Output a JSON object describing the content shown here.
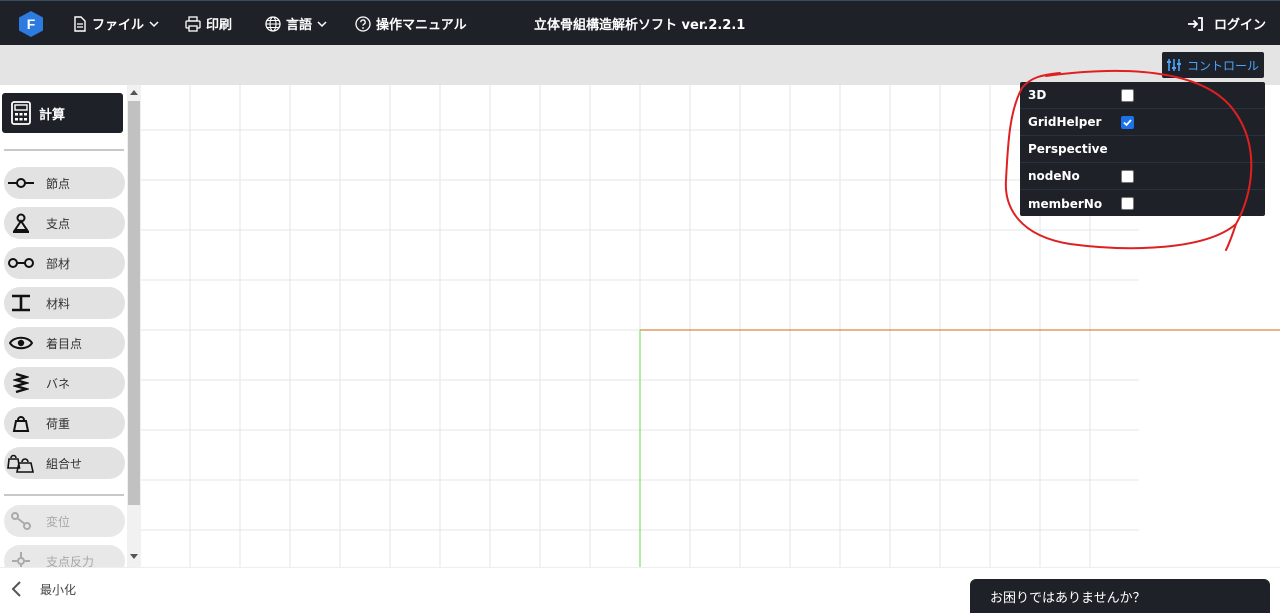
{
  "header": {
    "title": "立体骨組構造解析ソフト ver.2.2.1",
    "logo_letter": "F",
    "menu": {
      "file": "ファイル",
      "print": "印刷",
      "language": "言語",
      "manual": "操作マニュアル"
    },
    "login": "ログイン"
  },
  "toolbar": {
    "control_label": "コントロール"
  },
  "sidebar": {
    "calc_label": "計算",
    "items": [
      {
        "label": "節点",
        "icon": "node-icon"
      },
      {
        "label": "支点",
        "icon": "support-icon"
      },
      {
        "label": "部材",
        "icon": "member-icon"
      },
      {
        "label": "材料",
        "icon": "material-icon"
      },
      {
        "label": "着目点",
        "icon": "eye-icon"
      },
      {
        "label": "バネ",
        "icon": "spring-icon"
      },
      {
        "label": "荷重",
        "icon": "load-icon"
      },
      {
        "label": "組合せ",
        "icon": "combination-icon"
      }
    ],
    "result_items": [
      {
        "label": "変位",
        "icon": "displacement-icon"
      },
      {
        "label": "支点反力",
        "icon": "reaction-icon"
      }
    ]
  },
  "control_panel": {
    "rows": [
      {
        "label": "3D",
        "has_checkbox": true,
        "checked": false
      },
      {
        "label": "GridHelper",
        "has_checkbox": true,
        "checked": true
      },
      {
        "label": "Perspective",
        "has_checkbox": false,
        "checked": false
      },
      {
        "label": "nodeNo",
        "has_checkbox": true,
        "checked": false
      },
      {
        "label": "memberNo",
        "has_checkbox": true,
        "checked": false
      }
    ]
  },
  "bottom": {
    "minimize_label": "最小化",
    "help_label": "お困りではありませんか？"
  },
  "colors": {
    "header_bg": "#1e2228",
    "accent_blue": "#4aa3ff",
    "annotation_red": "#e02020",
    "axis_x": "#d2691e",
    "axis_y": "#66dd44",
    "grid": "#e6e6e6"
  }
}
